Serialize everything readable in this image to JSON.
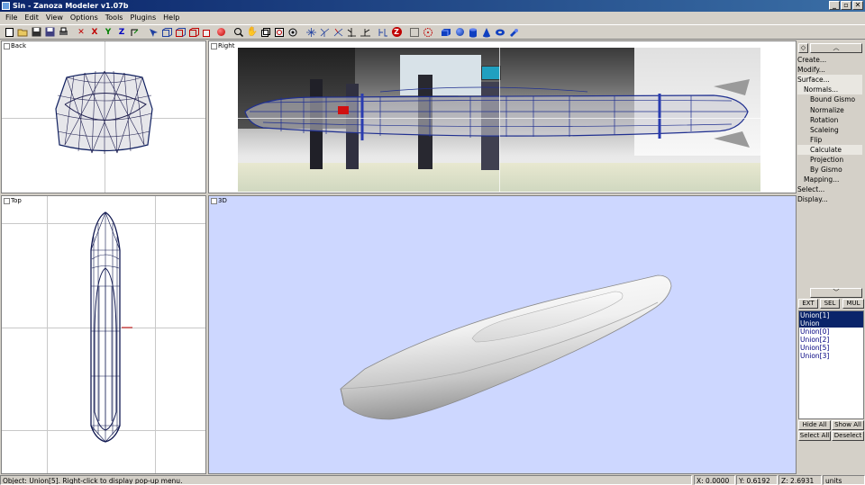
{
  "window": {
    "title": "Sin - Zanoza Modeler v1.07b",
    "controls": [
      "_",
      "▫",
      "✕"
    ]
  },
  "menu": [
    "File",
    "Edit",
    "View",
    "Options",
    "Tools",
    "Plugins",
    "Help"
  ],
  "toolbar": {
    "axis_x": "X",
    "axis_y": "Y",
    "axis_z": "Z",
    "z_logo": "Z"
  },
  "viewports": {
    "back": "Back",
    "right": "Right",
    "top": "Top",
    "view3d": "3D"
  },
  "panel": {
    "commands": [
      {
        "label": "Create...",
        "level": 0
      },
      {
        "label": "Modify...",
        "level": 0
      },
      {
        "label": "Surface...",
        "level": 0,
        "highlight": true
      },
      {
        "label": "Normals...",
        "level": 1,
        "highlight": true
      },
      {
        "label": "Bound Gismo",
        "level": 2
      },
      {
        "label": "Normalize",
        "level": 2
      },
      {
        "label": "Rotation",
        "level": 2
      },
      {
        "label": "Scaleing",
        "level": 2
      },
      {
        "label": "Flip",
        "level": 2
      },
      {
        "label": "Calculate",
        "level": 2,
        "highlight": true
      },
      {
        "label": "Projection",
        "level": 2
      },
      {
        "label": "By Gismo",
        "level": 2
      },
      {
        "label": "Mapping...",
        "level": 1
      },
      {
        "label": "Select...",
        "level": 0
      },
      {
        "label": "Display...",
        "level": 0
      }
    ],
    "mode_buttons": [
      "EXT",
      "SEL",
      "MUL"
    ],
    "objects": [
      "Union[1]",
      "Union",
      "Union[0]",
      "Union[2]",
      "Union[5]",
      "Union[3]"
    ],
    "selected_objects": [
      0,
      1
    ],
    "buttons": {
      "hide_all": "Hide All",
      "show_all": "Show All",
      "select_all": "Select All",
      "deselect": "Deselect"
    }
  },
  "status": {
    "message": "Object: Union[5]. Right-click to display pop-up menu.",
    "x": "X: 0.0000",
    "y": "Y: 0.6192",
    "z": "Z: 2.6931",
    "units": "units"
  }
}
